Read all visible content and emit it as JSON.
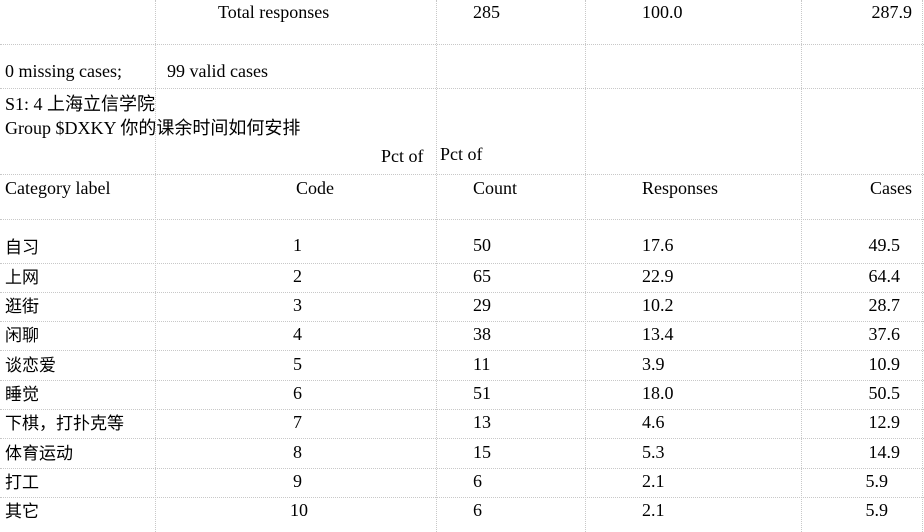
{
  "summary": {
    "total_label": "Total responses",
    "total_count": "285",
    "total_pct_responses": "100.0",
    "total_pct_cases": "287.9",
    "missing_cases": "0 missing cases;",
    "valid_cases": "99 valid cases"
  },
  "header": {
    "survey_line": "S1: 4 上海立信学院",
    "group_line": "Group $DXKY 你的课余时间如何安排",
    "pct_of_1": "Pct of",
    "pct_of_2": "Pct of",
    "col_category": "Category label",
    "col_code": "Code",
    "col_count": "Count",
    "col_responses": "Responses",
    "col_cases": "Cases"
  },
  "rows": [
    {
      "label": "自习",
      "code": "1",
      "count": "50",
      "pct_responses": "17.6",
      "pct_cases": "49.5"
    },
    {
      "label": "上网",
      "code": "2",
      "count": "65",
      "pct_responses": "22.9",
      "pct_cases": "64.4"
    },
    {
      "label": "逛街",
      "code": "3",
      "count": "29",
      "pct_responses": "10.2",
      "pct_cases": "28.7"
    },
    {
      "label": "闲聊",
      "code": "4",
      "count": "38",
      "pct_responses": "13.4",
      "pct_cases": "37.6"
    },
    {
      "label": "谈恋爱",
      "code": "5",
      "count": "11",
      "pct_responses": "3.9",
      "pct_cases": "10.9"
    },
    {
      "label": "睡觉",
      "code": "6",
      "count": "51",
      "pct_responses": "18.0",
      "pct_cases": "50.5"
    },
    {
      "label": "下棋，打扑克等",
      "code": "7",
      "count": "13",
      "pct_responses": "4.6",
      "pct_cases": "12.9"
    },
    {
      "label": "体育运动",
      "code": "8",
      "count": "15",
      "pct_responses": "5.3",
      "pct_cases": "14.9"
    },
    {
      "label": "打工",
      "code": "9",
      "count": "6",
      "pct_responses": "2.1",
      "pct_cases": "5.9"
    },
    {
      "label": "其它",
      "code": "10",
      "count": "6",
      "pct_responses": "2.1",
      "pct_cases": "5.9"
    }
  ]
}
